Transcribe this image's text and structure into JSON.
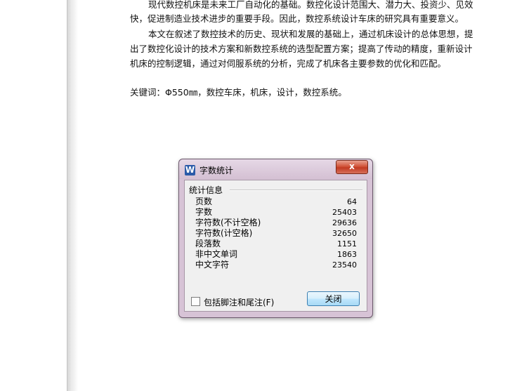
{
  "document": {
    "paragraph1_line1": "现代数控机床是未来工厂自动化的基础。数控化设计范围大、潜力大、投资少、见效",
    "paragraph1_line2": "快，促进制造业技术进步的重要手段。因此，数控系统设计车床的研究具有重要意义。",
    "paragraph2_line1": "本文在叙述了数控技术的历史、现状和发展的基础上，通过机床设计的总体思想，提",
    "paragraph2_line2": "出了数控化设计的技术方案和新数控系统的选型配置方案；提高了传动的精度，重新设计",
    "paragraph2_line3": "机床的控制逻辑，通过对伺服系统的分析，完成了机床各主要参数的优化和匹配。",
    "keywords": "关键词：Φ550㎜，数控车床，机床，设计，数控系统。"
  },
  "dialog": {
    "title": "字数统计",
    "icon": "wps-writer-icon",
    "close_glyph": "x",
    "group_title": "统计信息",
    "stats": [
      {
        "label": "页数",
        "value": "64"
      },
      {
        "label": "字数",
        "value": "25403"
      },
      {
        "label": "字符数(不计空格)",
        "value": "29636"
      },
      {
        "label": "字符数(计空格)",
        "value": "32650"
      },
      {
        "label": "段落数",
        "value": "1151"
      },
      {
        "label": "非中文单词",
        "value": "1863"
      },
      {
        "label": "中文字符",
        "value": "23540"
      }
    ],
    "checkbox_label": "包括脚注和尾注(F)",
    "checkbox_checked": false,
    "close_button": "关闭",
    "accent_color": "#d7c3d6"
  }
}
